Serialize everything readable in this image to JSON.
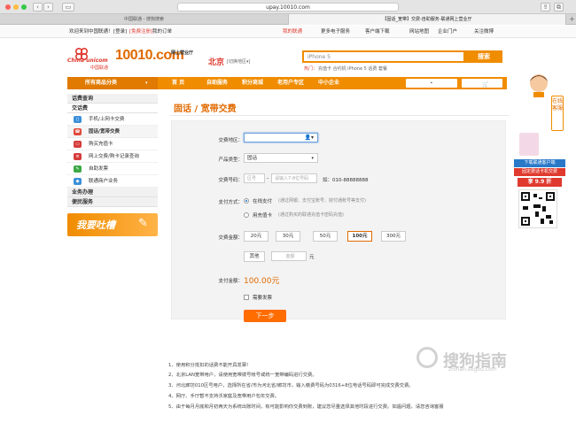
{
  "browser": {
    "url": "upay.10010.com",
    "tabs": [
      "中国联通 - 搜狗搜索",
      "【固话_宽带】交费-自助服务-联通网上营业厅"
    ]
  },
  "topbar": {
    "welcome": "欢迎来到中国联通！",
    "login": "[登录]",
    "register": "[免费注册]",
    "my_orders": "我的订单",
    "my_unicom": "我的联通",
    "more_download": "更多电子服务",
    "client_download": "客户端下载",
    "sitemap": "网站地图",
    "enterprise": "企业门户",
    "weibo": "关注微博"
  },
  "header": {
    "brand_en": "China unicom",
    "brand_cn": "中国联通",
    "hall_number": "10010.com",
    "hall_name": "网上营业厅",
    "city": "北京",
    "city_switch": "[切换地区▾]",
    "search_placeholder": "iPhone 5",
    "search_button": "搜索",
    "hot_label": "热门：",
    "hot_links": "充值卡  合约机  iPhone 5  话费  套餐"
  },
  "nav": {
    "all_categories": "所有商品分类",
    "items": [
      "首  页",
      "自助服务",
      "积分商城",
      "老用户专区",
      "中小企业"
    ],
    "unpaid_orders": "未付款订单",
    "cart": "去结算"
  },
  "sidebar": {
    "sections": [
      {
        "title": "话费查询"
      },
      {
        "title": "交话费"
      }
    ],
    "items": [
      {
        "label": "手机/上网卡交费",
        "icon": "phone-icon",
        "color": "#3a8fd8"
      },
      {
        "label": "固话/宽带交费",
        "icon": "landline-icon",
        "color": "#e04a3a"
      },
      {
        "label": "购买充值卡",
        "icon": "card-icon",
        "color": "#d63b3b"
      },
      {
        "label": "网上交费/购卡记录查询",
        "icon": "record-icon",
        "color": "#d63b3b"
      },
      {
        "label": "自助发票",
        "icon": "invoice-icon",
        "color": "#3aa843"
      },
      {
        "label": "联通商户业务",
        "icon": "merchant-icon",
        "color": "#3a8fd8"
      }
    ],
    "section_business": "业务办理",
    "section_convenience": "便民服务",
    "banner": "我要吐槽"
  },
  "main": {
    "title": "固话 / 宽带交费",
    "region_label": "交费地区：",
    "product_label": "产品类型：",
    "product_value": "固话",
    "number_label": "交费号码：",
    "area_placeholder": "区号",
    "number_placeholder": "请输入7-8位号码",
    "number_example": "如：010-88888888",
    "method_label": "支付方式：",
    "method_online": "在线支付",
    "method_online_hint": "(通过网银、支付宝账号、财付通账号等支付)",
    "method_card": "用充值卡",
    "method_card_hint": "(通过购买的联通充值卡密码充值)",
    "amount_label": "交费金额：",
    "amounts": [
      "20元",
      "30元",
      "50元",
      "100元",
      "300元"
    ],
    "selected_amount_index": 3,
    "other_label": "其他",
    "other_placeholder": "金额",
    "other_unit": "元",
    "pay_label": "支付金额：",
    "pay_value": "100.00元",
    "invoice_label": "需要发票",
    "next_button": "下一步"
  },
  "notes": [
    "1、使用积分抵扣的话费不能开具发票!",
    "2、北京LAN宽带用户，请使用宽带拨号帐号或统一宽带编码进行交费。",
    "3、河北廊坊010区号用户，选择所在省/市为河北省/廊坊市，输入缴费号码为0316+8位电话号码即可完成交费交费。",
    "4、网厅、手厅暂不支持沃家庭及宽带用户包年交费。",
    "5、由于每月月底和月初两天为系统出账时间，有可能影响你交费到账，建议您尽量选择其他时段进行交费。如遇问题，请您咨询客服"
  ],
  "side_ad": {
    "service": "在线客服",
    "download_title": "下载联通客户端",
    "download_sub": "固定费话卡机交费",
    "discount": "享 9.9 折"
  },
  "watermark": {
    "text": "搜狗指南",
    "url": "zhinan.sogou.com"
  },
  "colors": {
    "orange": "#f08c00",
    "title_orange": "#e16a00",
    "next_button": "#ff6c00",
    "red": "#e03a2f"
  }
}
